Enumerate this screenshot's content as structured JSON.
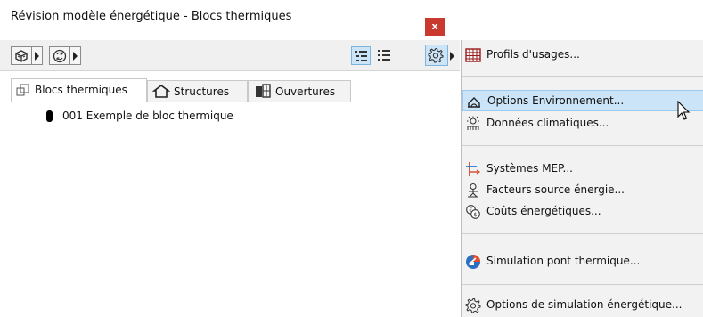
{
  "window": {
    "title": "Révision modèle énergétique - Blocs thermiques",
    "close_label": "x"
  },
  "toolbar": {
    "buttons": [
      "3d-model-icon",
      "refresh-icon",
      "tree-view-icon",
      "list-view-icon",
      "gear-icon"
    ]
  },
  "tabs": [
    {
      "label": "Blocs thermiques",
      "icon": "thermal-blocks-icon",
      "active": true
    },
    {
      "label": "Structures",
      "icon": "house-icon",
      "active": false
    },
    {
      "label": "Ouvertures",
      "icon": "window-icon",
      "active": false
    }
  ],
  "tree": {
    "items": [
      {
        "label": "001 Exemple de bloc thermique"
      }
    ]
  },
  "menu": {
    "items": [
      {
        "label": "Profils d'usages...",
        "icon": "grid-table-icon"
      },
      {
        "label": "Options Environnement...",
        "icon": "environment-icon",
        "highlighted": true
      },
      {
        "label": "Données climatiques...",
        "icon": "sun-cloud-icon"
      },
      {
        "label": "Systèmes MEP...",
        "icon": "mep-icon"
      },
      {
        "label": "Facteurs source énergie...",
        "icon": "energy-source-icon"
      },
      {
        "label": "Coûts énergétiques...",
        "icon": "coins-icon"
      },
      {
        "label": "Simulation pont thermique...",
        "icon": "thermal-bridge-icon"
      },
      {
        "label": "Options de simulation énergétique...",
        "icon": "gear-icon"
      }
    ]
  },
  "colors": {
    "close": "#c9392f",
    "highlight": "#cce4f7",
    "highlight_border": "#99c9ef",
    "menu_bg": "#f2f2f2"
  }
}
